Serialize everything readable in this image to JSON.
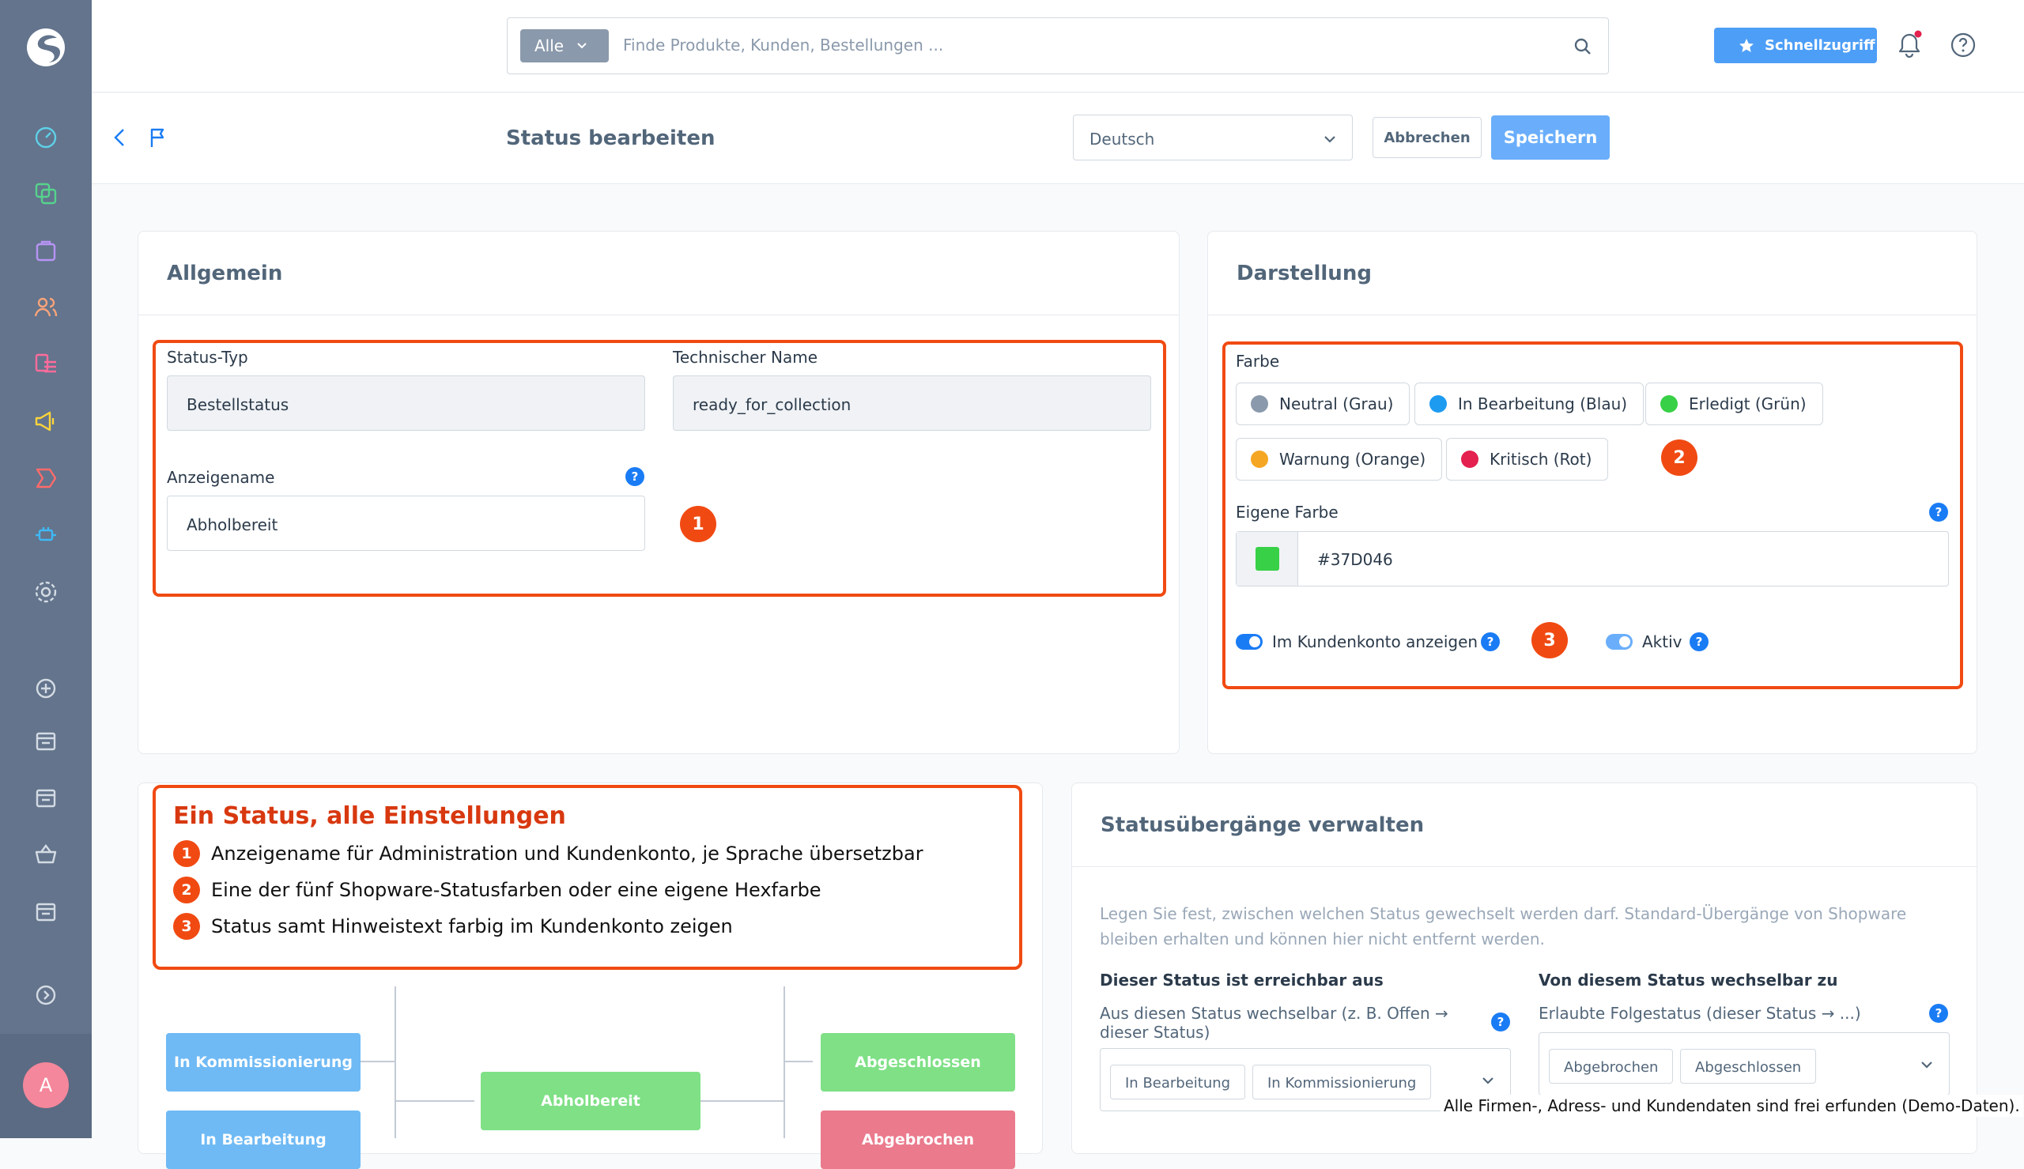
{
  "topbar": {
    "search_scope": "Alle",
    "search_placeholder": "Finde Produkte, Kunden, Bestellungen ...",
    "quick_access_label": "Schnellzugriff"
  },
  "sidebar": {
    "avatar_initial": "A",
    "items": [
      "dashboard-icon",
      "catalog-icon",
      "orders-icon",
      "customers-icon",
      "content-icon",
      "marketing-icon",
      "promotions-icon",
      "extensions-icon",
      "settings-icon",
      "add-channel-icon",
      "sales-channel-icon",
      "sales-channel-icon",
      "basket-icon",
      "sales-channel-icon",
      "expand-icon"
    ]
  },
  "smartbar": {
    "title": "Status bearbeiten",
    "language": "Deutsch",
    "cancel_label": "Abbrechen",
    "save_label": "Speichern"
  },
  "general": {
    "title": "Allgemein",
    "status_type_label": "Status-Typ",
    "status_type_value": "Bestellstatus",
    "technical_name_label": "Technischer Name",
    "technical_name_value": "ready_for_collection",
    "display_name_label": "Anzeigename",
    "display_name_value": "Abholbereit"
  },
  "appearance": {
    "title": "Darstellung",
    "color_label": "Farbe",
    "colors": [
      {
        "label": "Neutral (Grau)",
        "hex": "#8a99ab"
      },
      {
        "label": "In Bearbeitung (Blau)",
        "hex": "#1d9bf0"
      },
      {
        "label": "Erledigt (Grün)",
        "hex": "#37d046"
      },
      {
        "label": "Warnung (Orange)",
        "hex": "#f5a623"
      },
      {
        "label": "Kritisch (Rot)",
        "hex": "#e3204e"
      }
    ],
    "custom_color_label": "Eigene Farbe",
    "custom_color_value": "#37D046",
    "toggle_customer_label": "Im Kundenkonto anzeigen",
    "toggle_active_label": "Aktiv"
  },
  "annotations": {
    "n1": "1",
    "n2": "2",
    "n3": "3",
    "legend_title": "Ein Status, alle Einstellungen",
    "legend_items": [
      "Anzeigename für Administration und Kundenkonto, je Sprache übersetzbar",
      "Eine der fünf Shopware-Statusfarben oder eine eigene Hexfarbe",
      "Status samt Hinweistext farbig im Kundenkonto zeigen"
    ]
  },
  "flow": {
    "left_nodes": [
      "In Kommissionierung",
      "In Bearbeitung"
    ],
    "center_node": "Abholbereit",
    "right_nodes": [
      "Abgeschlossen",
      "Abgebrochen"
    ],
    "colors": {
      "blue": "#6fbaf5",
      "green": "#7fe086",
      "red": "#ea7a8c"
    }
  },
  "transitions": {
    "title": "Statusübergänge verwalten",
    "description": "Legen Sie fest, zwischen welchen Status gewechselt werden darf. Standard-Übergänge von Shopware bleiben erhalten und können hier nicht entfernt werden.",
    "from_heading": "Dieser Status ist erreichbar aus",
    "from_sub": "Aus diesen Status wechselbar (z. B. Offen → dieser Status)",
    "from_tags": [
      "In Bearbeitung",
      "In Kommissionierung"
    ],
    "to_heading": "Von diesem Status wechselbar zu",
    "to_sub": "Erlaubte Folgestatus (dieser Status → ...)",
    "to_tags": [
      "Abgebrochen",
      "Abgeschlossen"
    ]
  },
  "footnote": "Alle Firmen-, Adress- und Kundendaten sind frei erfunden (Demo-Daten)."
}
